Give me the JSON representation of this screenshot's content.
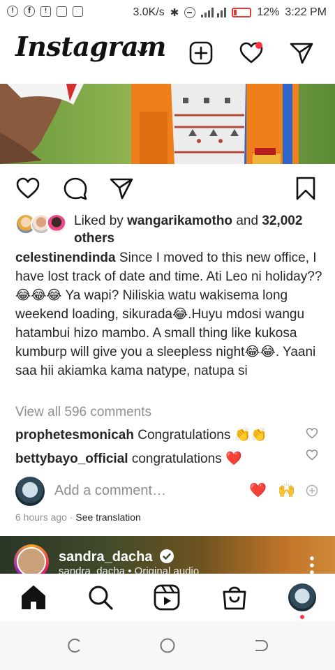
{
  "status_bar": {
    "net_speed": "3.0K/s",
    "battery": "12%",
    "time": "3:22 PM",
    "icons": [
      "alert-icon",
      "facebook-icon",
      "notification-icon",
      "sim-icon",
      "gallery-icon",
      "bluetooth-icon",
      "dnd-icon",
      "signal-icon",
      "battery-icon"
    ],
    "battery_color": "#e53935"
  },
  "header": {
    "logo": "Instagram",
    "icons": [
      "chevron-down-icon",
      "new-post-icon",
      "activity-heart-icon",
      "direct-messages-icon"
    ],
    "notification_dot_color": "#ff3040"
  },
  "post": {
    "actions": [
      "like-icon",
      "comment-icon",
      "share-icon",
      "save-icon"
    ],
    "likes": {
      "prefix": "Liked by",
      "user": "wangarikamotho",
      "joiner": "and",
      "count": "32,002",
      "suffix": "others"
    },
    "caption": {
      "user": "celestinendinda",
      "text": "Since I moved to this new office, I have lost track of date and time. Ati Leo ni holiday?? 😂😂😂 Ya wapi? Niliskia watu wakisema long weekend loading, sikurada😂.Huyu mdosi wangu hatambui hizo mambo. A small thing like kukosa kumburp will give you a sleepless night😂😂. Yaani saa hii akiamka kama natype, natupa si"
    },
    "view_comments": "View all 596 comments",
    "comments": [
      {
        "user": "prophetesmonicah",
        "text": "Congratulations 👏👏"
      },
      {
        "user": "bettybayo_official",
        "text": "congratulations ❤️"
      }
    ],
    "add_comment_placeholder": "Add a comment…",
    "quick_reactions": [
      "❤️",
      "🙌"
    ],
    "timestamp": "6 hours ago",
    "separator": "·",
    "see_translation": "See translation"
  },
  "next_post": {
    "username": "sandra_dacha",
    "subtitle": "sandra_dacha • Original audio",
    "verified": true
  },
  "bottom_nav": {
    "items": [
      "home-icon",
      "search-icon",
      "reels-icon",
      "shop-icon",
      "profile-avatar"
    ],
    "dot_color": "#ff3040"
  },
  "system_nav": [
    "recents-button",
    "home-button",
    "back-button"
  ]
}
